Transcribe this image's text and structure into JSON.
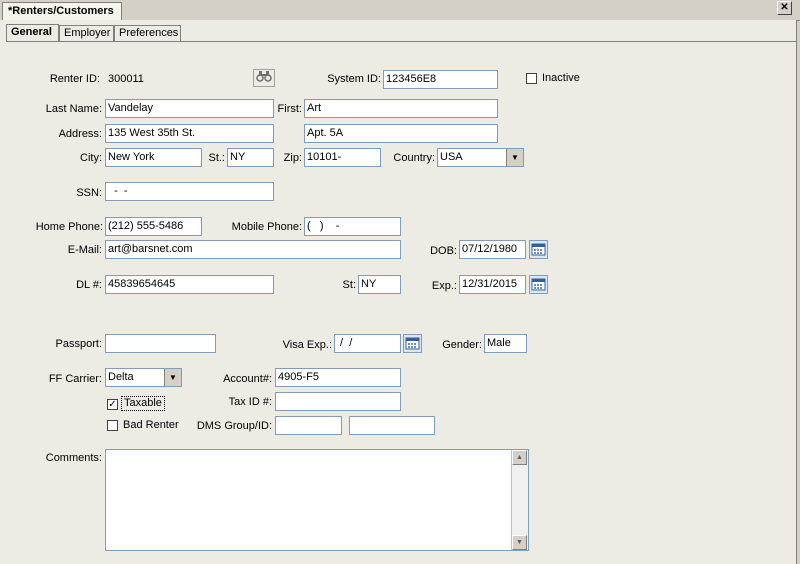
{
  "window": {
    "doc_tab": "*Renters/Customers",
    "close_glyph": "✕"
  },
  "tabs": [
    {
      "label": "General"
    },
    {
      "label": "Employer"
    },
    {
      "label": "Preferences"
    }
  ],
  "form": {
    "renter_id_label": "Renter ID:",
    "renter_id": "300011",
    "system_id_label": "System ID:",
    "system_id": "123456E8",
    "inactive_label": "Inactive",
    "last_name_label": "Last Name:",
    "last_name": "Vandelay",
    "first_label": "First:",
    "first": "Art",
    "address_label": "Address:",
    "address1": "135 West 35th St.",
    "address2": "Apt. 5A",
    "city_label": "City:",
    "city": "New York",
    "st_label": "St.:",
    "st": "NY",
    "zip_label": "Zip:",
    "zip": "10101-",
    "country_label": "Country:",
    "country": "USA",
    "ssn_label": "SSN:",
    "ssn": "  -  -",
    "home_phone_label": "Home Phone:",
    "home_phone": "(212) 555-5486",
    "mobile_phone_label": "Mobile Phone:",
    "mobile_phone": "(   )    -",
    "email_label": "E-Mail:",
    "email": "art@barsnet.com",
    "dob_label": "DOB:",
    "dob": "07/12/1980",
    "dl_label": "DL #:",
    "dl": "45839654645",
    "dl_st_label": "St:",
    "dl_st": "NY",
    "exp_label": "Exp.:",
    "exp": "12/31/2015",
    "passport_label": "Passport:",
    "passport": "",
    "visa_exp_label": "Visa Exp.:",
    "visa_exp": " /  /",
    "gender_label": "Gender:",
    "gender": "Male",
    "ff_carrier_label": "FF Carrier:",
    "ff_carrier": "Delta",
    "account_label": "Account#:",
    "account": "4905-F5",
    "taxable_label": "Taxable",
    "tax_id_label": "Tax ID #:",
    "tax_id": "",
    "bad_renter_label": "Bad Renter",
    "dms_label": "DMS Group/ID:",
    "dms_group": "",
    "dms_id": "",
    "comments_label": "Comments:",
    "comments": ""
  },
  "icons": {
    "binoculars": "binoculars-icon",
    "calendar": "calendar-icon",
    "dropdown": "▼",
    "check": "✓",
    "scroll_up": "▲",
    "scroll_down": "▼"
  },
  "checks": {
    "inactive": false,
    "taxable": true,
    "bad_renter": false
  },
  "colors": {
    "window_bg": "#d4d0c8",
    "panel_bg": "#ecebe4",
    "field_border": "#7f9db9"
  }
}
